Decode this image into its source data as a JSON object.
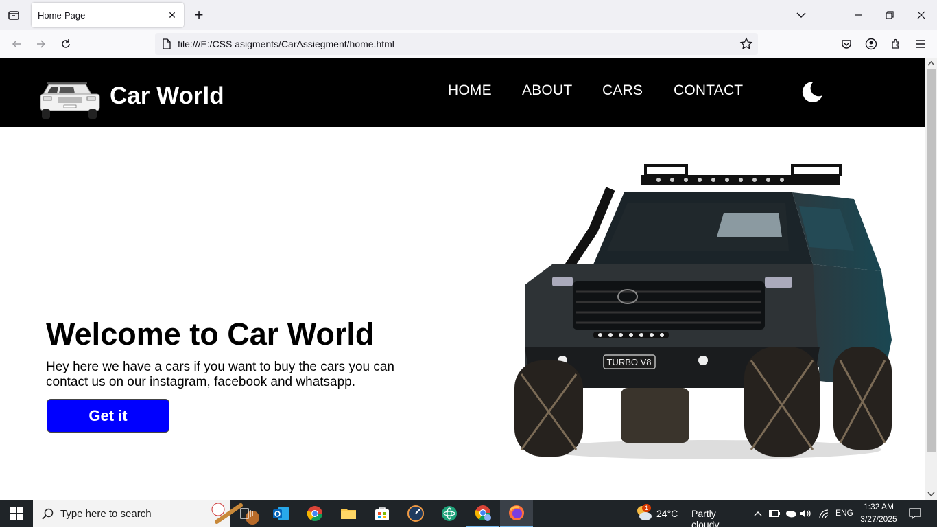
{
  "browser": {
    "tab": {
      "title": "Home-Page",
      "close": "✕"
    },
    "new_tab": "+",
    "url": "file:///E:/CSS asigments/CarAssiegment/home.html"
  },
  "site": {
    "brand": "Car World",
    "nav": [
      "HOME",
      "ABOUT",
      "CARS",
      "CONTACT"
    ],
    "hero": {
      "title": "Welcome to Car World",
      "text": "Hey here we have a cars if you want to buy the cars you can contact us on our instagram, facebook and whatsapp.",
      "button": "Get it",
      "plate": "TURBO V8"
    },
    "colors": {
      "header_bg": "#000000",
      "button_bg": "#0000ff",
      "text": "#000000"
    }
  },
  "taskbar": {
    "search_placeholder": "Type here to search",
    "weather": {
      "temp": "24°C",
      "desc": "Partly cloudy",
      "badge": "1"
    },
    "lang": "ENG",
    "time": "1:32 AM",
    "date": "3/27/2025"
  }
}
